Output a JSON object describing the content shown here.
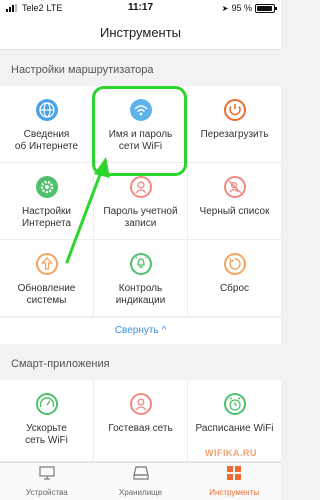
{
  "status_bar": {
    "carrier": "Tele2",
    "network": "LTE",
    "time": "11:17",
    "battery": "95 %",
    "battery_level": 0.95
  },
  "header": {
    "title": "Инструменты"
  },
  "router_section": {
    "title": "Настройки маршрутизатора",
    "items": [
      {
        "label": "Сведения\nоб Интернете",
        "icon": "globe-icon"
      },
      {
        "label": "Имя и пароль\nсети WiFi",
        "icon": "wifi-icon"
      },
      {
        "label": "Перезагрузить",
        "icon": "power-icon"
      },
      {
        "label": "Настройки\nИнтернета",
        "icon": "gear-icon"
      },
      {
        "label": "Пароль учетной\nзаписи",
        "icon": "user-icon"
      },
      {
        "label": "Черный список",
        "icon": "blacklist-icon"
      },
      {
        "label": "Обновление\nсистемы",
        "icon": "upgrade-icon"
      },
      {
        "label": "Контроль\nиндикации",
        "icon": "indicator-icon"
      },
      {
        "label": "Сброс",
        "icon": "reset-icon"
      }
    ],
    "collapse_label": "Свернуть ^"
  },
  "apps_section": {
    "title": "Смарт-приложения",
    "items": [
      {
        "label": "Ускорьте\nсеть WiFi",
        "icon": "speedometer-icon"
      },
      {
        "label": "Гостевая сеть",
        "icon": "guest-network-icon"
      },
      {
        "label": "Расписание WiFi",
        "icon": "alarm-clock-icon"
      }
    ]
  },
  "bottom_tabs": [
    {
      "label": "Устройства",
      "icon": "monitor-icon",
      "active": false
    },
    {
      "label": "Хранилище",
      "icon": "storage-icon",
      "active": false
    },
    {
      "label": "Инструменты",
      "icon": "tools-icon",
      "active": true
    }
  ],
  "watermark": "WIFIKA.RU",
  "colors": {
    "accent": "#ef6b33",
    "link": "#3a8ee6",
    "highlight": "#2bd52b"
  }
}
